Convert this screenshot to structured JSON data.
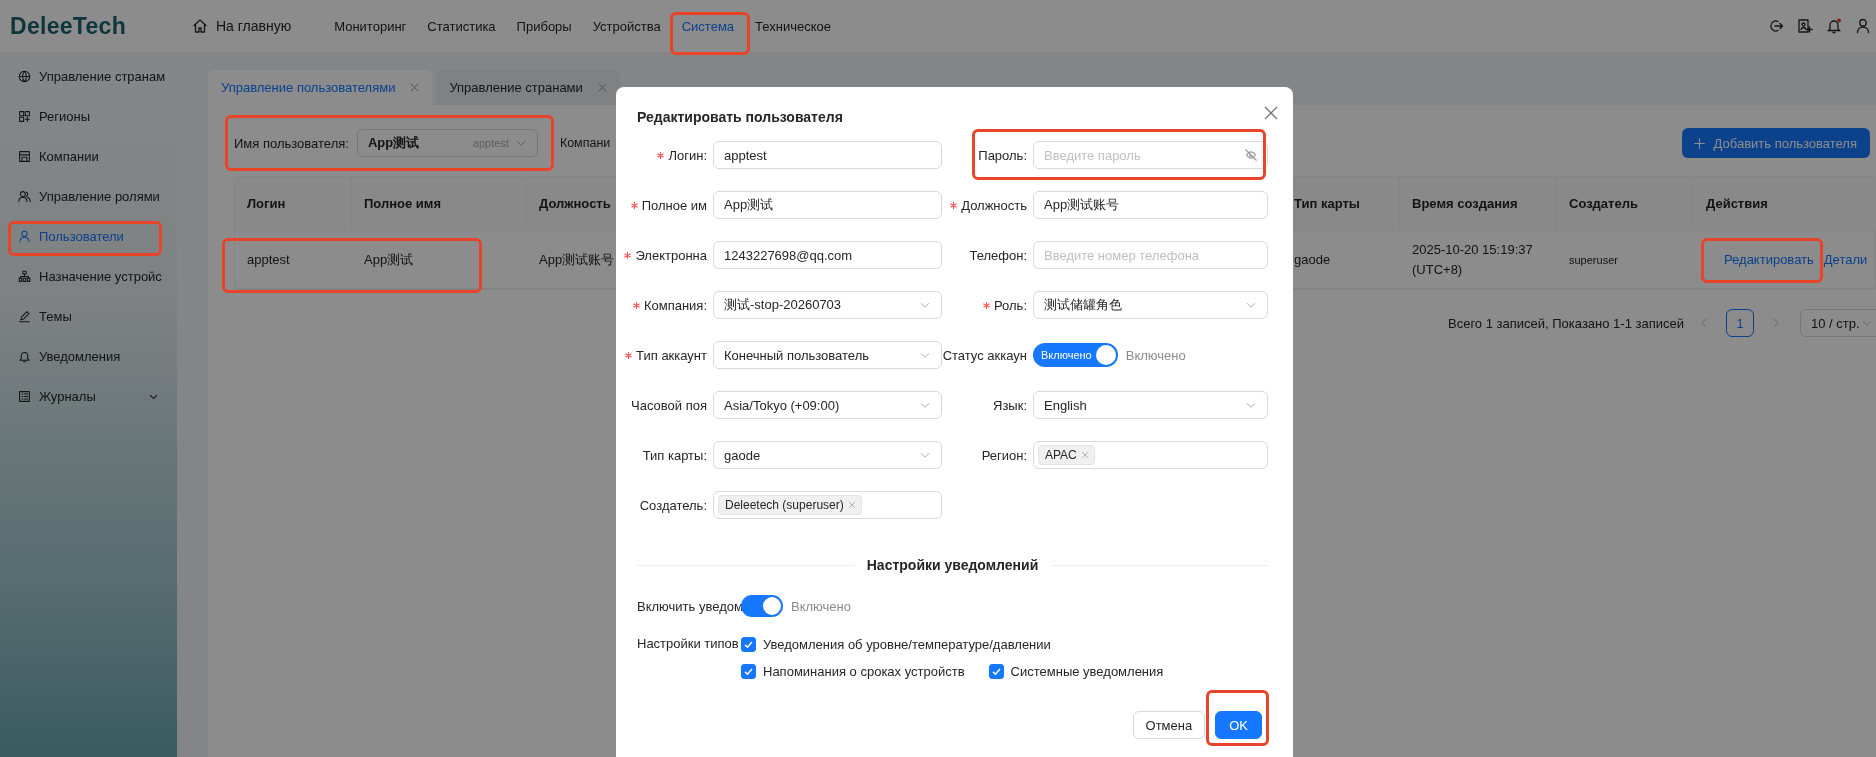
{
  "header": {
    "logo": "DeleeTech",
    "home": {
      "label": "На главную"
    },
    "nav": [
      {
        "label": "Мониторинг",
        "selected": false,
        "highlighted": false
      },
      {
        "label": "Статистика",
        "selected": false,
        "highlighted": false
      },
      {
        "label": "Приборы",
        "selected": false,
        "highlighted": false
      },
      {
        "label": "Устройства",
        "selected": false,
        "highlighted": false
      },
      {
        "label": "Система",
        "selected": true,
        "highlighted": true
      },
      {
        "label": "Техническое",
        "selected": false,
        "highlighted": false
      }
    ]
  },
  "sidebar": {
    "items": [
      {
        "label": "Управление странам",
        "selected": false,
        "highlighted": false
      },
      {
        "label": "Регионы",
        "selected": false,
        "highlighted": false
      },
      {
        "label": "Компании",
        "selected": false,
        "highlighted": false
      },
      {
        "label": "Управление ролями",
        "selected": false,
        "highlighted": false
      },
      {
        "label": "Пользователи",
        "selected": true,
        "highlighted": true
      },
      {
        "label": "Назначение устройс",
        "selected": false,
        "highlighted": false
      },
      {
        "label": "Темы",
        "selected": false,
        "highlighted": false
      },
      {
        "label": "Уведомления",
        "selected": false,
        "highlighted": false
      },
      {
        "label": "Журналы",
        "selected": false,
        "highlighted": false,
        "expanded": false
      }
    ]
  },
  "tabs": [
    {
      "label": "Управление пользователями",
      "selected": true
    },
    {
      "label": "Управление странами",
      "selected": false
    }
  ],
  "filters": {
    "user": {
      "label": "Имя пользователя:",
      "value": "App测试",
      "hint": "apptest",
      "highlighted": true
    },
    "company_label": "Компани"
  },
  "add_button": {
    "label": "Добавить пользователя"
  },
  "table": {
    "columns": [
      "Логин",
      "Полное имя",
      "Должность",
      "Тип карты",
      "Время создания",
      "Создатель",
      "Действия"
    ],
    "rows": [
      {
        "highlighted": true,
        "cells": [
          "apptest",
          "App测试",
          "App测试账号",
          "gaode",
          "2025-10-20 15:19:37 (UTC+8)",
          "superuser"
        ],
        "actions": [
          {
            "label": "Редактировать",
            "highlighted": true
          },
          {
            "label": "Детали",
            "highlighted": false
          }
        ]
      }
    ]
  },
  "pagination": {
    "summary": "Всего 1 записей, Показано 1-1 записей",
    "pages": [
      {
        "label": "1",
        "selected": true
      }
    ],
    "page_size": "10 / стр."
  },
  "modal": {
    "title": "Редактировать пользователя",
    "fields": [
      {
        "label": "Логин:",
        "required": true,
        "kind": "input",
        "value": "apptest"
      },
      {
        "label": "Пароль:",
        "required": false,
        "kind": "password",
        "placeholder": "Введите пароль",
        "highlighted": true
      },
      {
        "label": "Полное им",
        "required": true,
        "kind": "input",
        "value": "App测试"
      },
      {
        "label": "Должность",
        "required": true,
        "kind": "input",
        "value": "App测试账号"
      },
      {
        "label": "Электронна",
        "required": true,
        "kind": "input",
        "value": "1243227698@qq.com"
      },
      {
        "label": "Телефон:",
        "required": false,
        "kind": "input",
        "placeholder": "Введите номер телефона"
      },
      {
        "label": "Компания:",
        "required": true,
        "kind": "select",
        "value": "测试-stop-20260703"
      },
      {
        "label": "Роль:",
        "required": true,
        "kind": "select",
        "value": "测试储罐角色"
      },
      {
        "label": "Тип аккаунт",
        "required": true,
        "kind": "select",
        "value": "Конечный пользователь"
      },
      {
        "label": "Статус аккаун",
        "required": false,
        "kind": "switch",
        "on": true,
        "inner": "Включено",
        "status": "Включено"
      },
      {
        "label": "Часовой поя",
        "required": false,
        "kind": "select",
        "value": "Asia/Tokyo (+09:00)"
      },
      {
        "label": "Язык:",
        "required": false,
        "kind": "select",
        "value": "English"
      },
      {
        "label": "Тип карты:",
        "required": false,
        "kind": "select",
        "value": "gaode"
      },
      {
        "label": "Регион:",
        "required": false,
        "kind": "tags",
        "tags": [
          "APAC"
        ]
      },
      {
        "label": "Создатель:",
        "required": false,
        "kind": "tags",
        "tags": [
          "Deleetech (superuser)"
        ]
      }
    ],
    "section_title": "Настройки уведомлений",
    "notify": {
      "label": "Включить уведом",
      "on": true,
      "status": "Включено"
    },
    "types": {
      "label": "Настройки типов",
      "options": [
        {
          "label": "Уведомления об уровне/температуре/давлении",
          "checked": true
        },
        {
          "label": "Напоминания о сроках устройств",
          "checked": true
        },
        {
          "label": "Системные уведомления",
          "checked": true
        }
      ]
    },
    "buttons": [
      {
        "label": "Отмена",
        "kind": "default",
        "highlighted": false
      },
      {
        "label": "OK",
        "kind": "primary",
        "highlighted": true
      }
    ]
  }
}
